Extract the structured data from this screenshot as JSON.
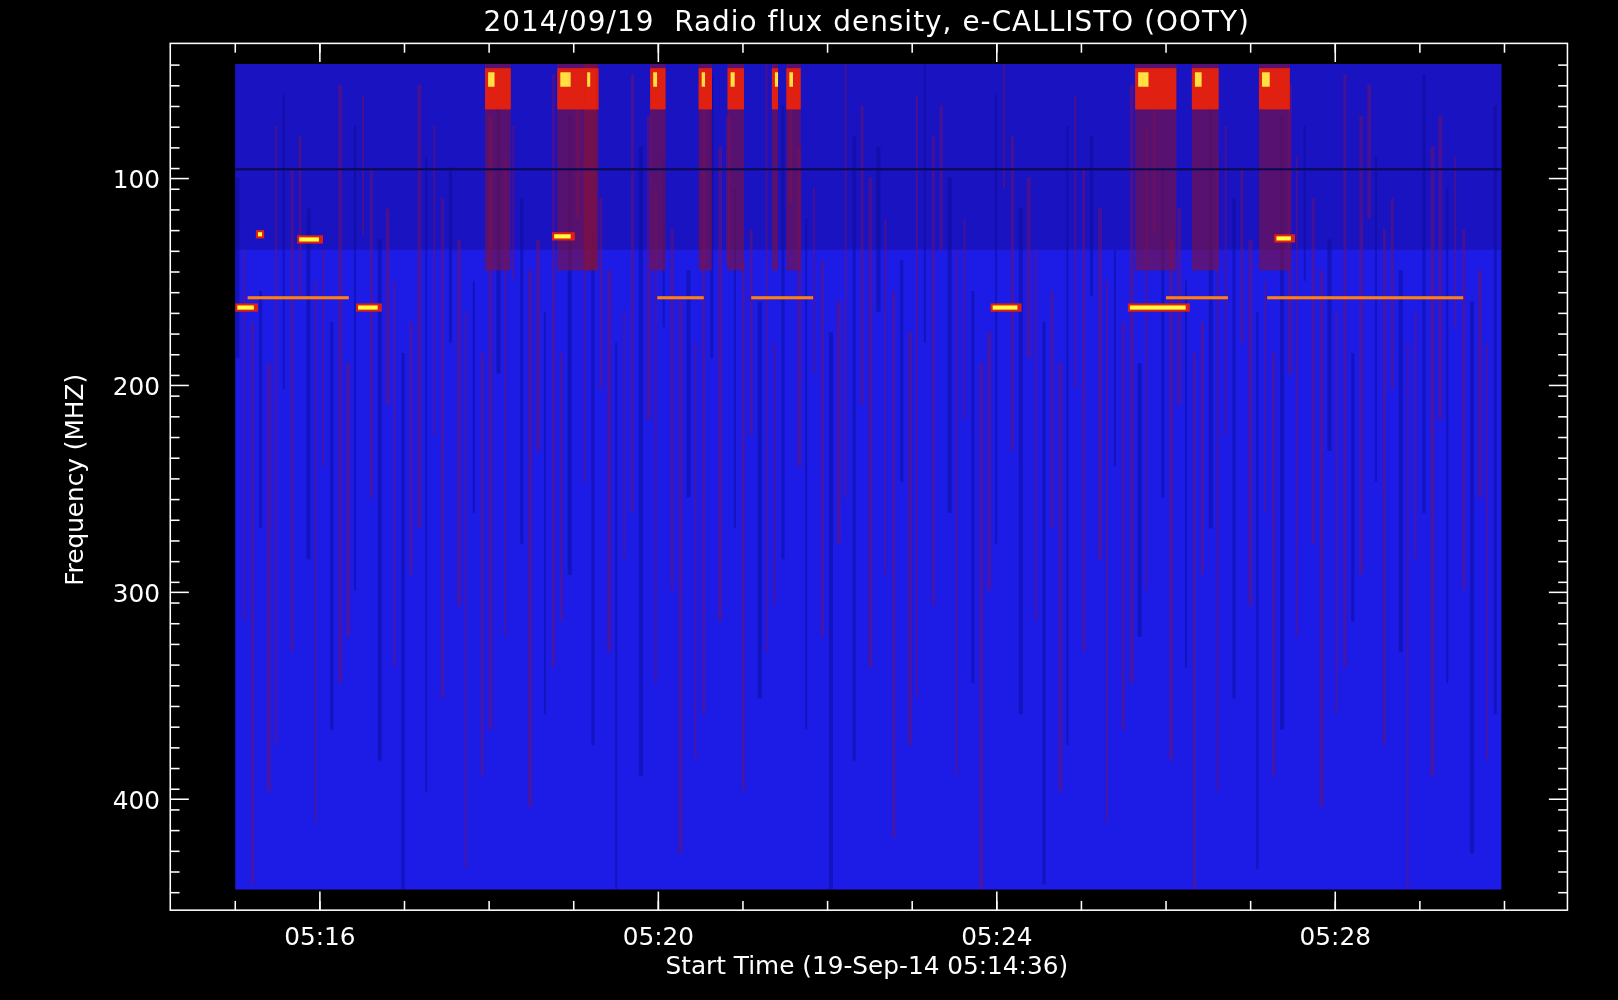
{
  "plot": {
    "title": "2014/09/19  Radio flux density, e-CALLISTO (OOTY)",
    "y_axis": {
      "label": "Frequency (MHZ)",
      "ticks": [
        "100",
        "200",
        "300",
        "400"
      ]
    },
    "x_axis": {
      "label": "Start Time (19-Sep-14 05:14:36)",
      "ticks": [
        "05:16",
        "05:20",
        "05:24",
        "05:28"
      ]
    }
  }
}
